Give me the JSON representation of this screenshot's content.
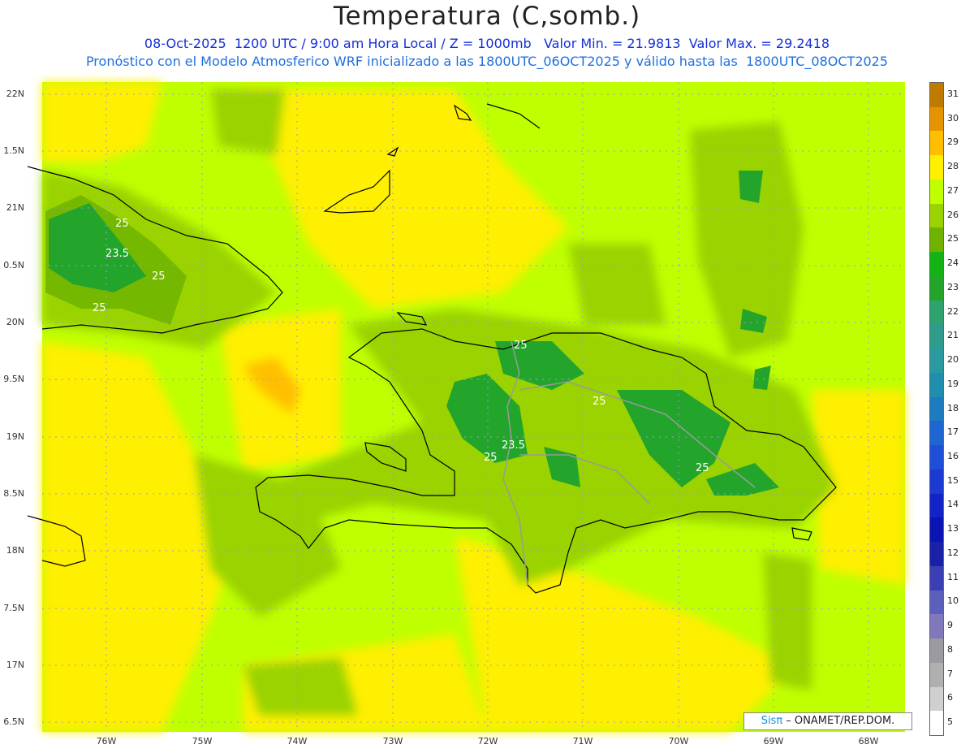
{
  "header": {
    "title": "Temperatura (C,somb.)",
    "line1": "08-Oct-2025  1200 UTC / 9:00 am Hora Local / Z = 1000mb   Valor Min. = 21.9813  Valor Max. = 29.2418",
    "line2": "Pronóstico con el Modelo Atmosferico WRF inicializado a las 1800UTC_06OCT2025 y válido hasta las  1800UTC_08OCT2025"
  },
  "axes": {
    "lat_labels": [
      "22N",
      "1.5N",
      "21N",
      "0.5N",
      "20N",
      "9.5N",
      "19N",
      "8.5N",
      "18N",
      "7.5N",
      "17N",
      "6.5N"
    ],
    "lon_labels": [
      "76W",
      "75W",
      "74W",
      "73W",
      "72W",
      "71W",
      "70W",
      "69W",
      "68W"
    ]
  },
  "contour_labels": [
    "25",
    "23.5",
    "25",
    "25",
    "25",
    "25",
    "23.5",
    "25",
    "25"
  ],
  "colorbar": {
    "labels": [
      "31",
      "30",
      "29",
      "28",
      "27",
      "26",
      "25",
      "24",
      "23",
      "22",
      "21",
      "20",
      "19",
      "18",
      "17",
      "16",
      "15",
      "14",
      "13",
      "12",
      "11",
      "10",
      "9",
      "8",
      "7",
      "6",
      "5"
    ],
    "colors": [
      "#c07a00",
      "#e59400",
      "#ffbf00",
      "#ffef00",
      "#bfff00",
      "#9ad300",
      "#6fb300",
      "#14b314",
      "#23a52c",
      "#2ea36e",
      "#2e9b8b",
      "#2a9aa0",
      "#208fae",
      "#1d7cc0",
      "#1e67d0",
      "#1f4fd6",
      "#1b3ad2",
      "#1024c8",
      "#0a14b4",
      "#1a20a8",
      "#3a3fb4",
      "#5b60bc",
      "#8078bc",
      "#9a9aa0",
      "#b0b0b0",
      "#d0d0d0",
      "#ffffff"
    ]
  },
  "credit": {
    "brand": "Sisπ",
    "text": " – ONAMET/REP.DOM."
  }
}
